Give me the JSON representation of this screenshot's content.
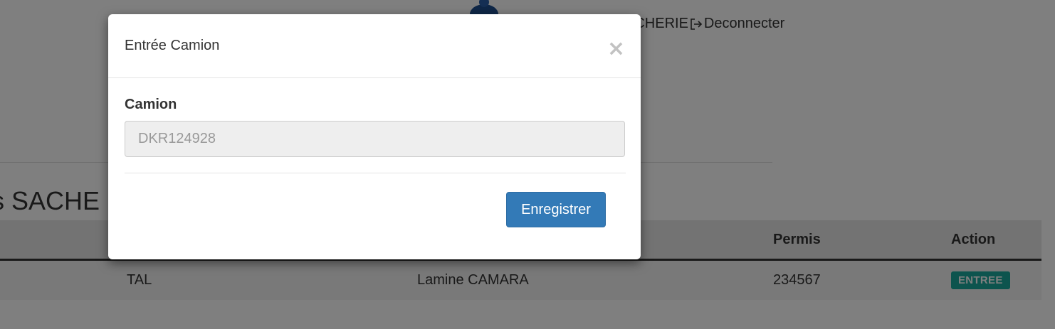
{
  "header": {
    "user_fragment": "ACHERIE",
    "logout_label": "Deconnecter"
  },
  "page": {
    "title_fragment": "ns SACHE"
  },
  "table": {
    "columns": [
      "",
      "",
      "",
      "Permis",
      "Action"
    ],
    "rows": [
      {
        "col1": "",
        "col2": "TAL",
        "col3": "Lamine CAMARA",
        "permis": "234567",
        "action": "ENTREE"
      }
    ]
  },
  "modal": {
    "title": "Entrée Camion",
    "close_symbol": "×",
    "field_label": "Camion",
    "field_placeholder": "DKR124928",
    "submit_label": "Enregistrer"
  },
  "colors": {
    "primary": "#337ab7",
    "badge": "#1aa89d",
    "backdrop": "rgba(0,0,0,0.5)"
  },
  "icons": {
    "logo": "logo-icon",
    "logout": "logout-icon",
    "close": "close-icon"
  }
}
